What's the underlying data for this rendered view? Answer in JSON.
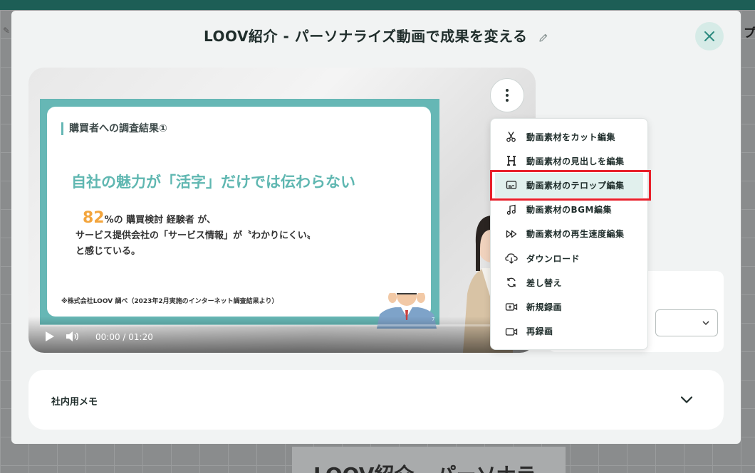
{
  "background": {
    "right_partial_text": "プ",
    "bottom_partial_title": "LOOV紹介 - パーソナラ"
  },
  "modal": {
    "title": "LOOV紹介 - パーソナライズ動画で成果を変える"
  },
  "video": {
    "slide": {
      "heading": "購買者への調査結果①",
      "headline": "自社の魅力が「活字」だけでは伝わらない",
      "percent": "82",
      "line1_rest": "%の 購買検討 経験者 が、",
      "line2": "サービス提供会社の「サービス情報」が〝わかりにくい〟",
      "line3": "と感じている。",
      "note": "※株式会社LOOV 調べ（2023年2月実施のインターネット調査結果より）",
      "page_number": "7"
    },
    "time": "00:00 / 01:20",
    "progress": 0
  },
  "menu": {
    "items": [
      {
        "label": "動画素材をカット編集",
        "icon": "scissors-icon"
      },
      {
        "label": "動画素材の見出しを編集",
        "icon": "heading-icon"
      },
      {
        "label": "動画素材のテロップ編集",
        "icon": "caption-icon"
      },
      {
        "label": "動画素材のBGM編集",
        "icon": "music-note-icon"
      },
      {
        "label": "動画素材の再生速度編集",
        "icon": "fast-forward-icon"
      },
      {
        "label": "ダウンロード",
        "icon": "cloud-download-icon"
      },
      {
        "label": "差し替え",
        "icon": "replace-icon"
      },
      {
        "label": "新規録画",
        "icon": "new-recording-icon"
      },
      {
        "label": "再録画",
        "icon": "video-camera-icon"
      }
    ],
    "highlighted_index": 2
  },
  "memo": {
    "label": "社内用メモ"
  },
  "colors": {
    "accent": "#66b7b5",
    "highlight": "#e8202a",
    "close_bg": "#d6ebe7"
  }
}
